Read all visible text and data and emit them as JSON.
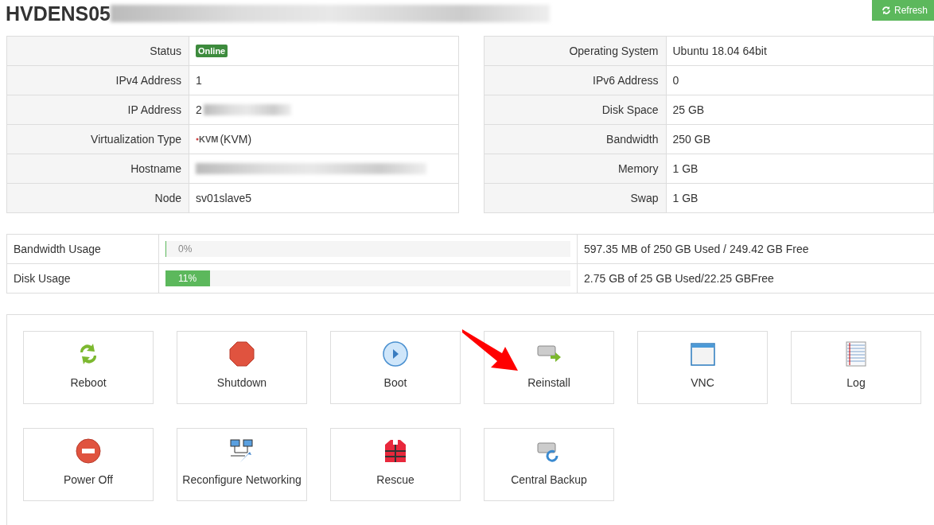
{
  "title": "HVDENS05",
  "refresh_button": {
    "label": "Refresh"
  },
  "info_left": [
    {
      "label": "Status",
      "kind": "badge",
      "value": "Online"
    },
    {
      "label": "IPv4 Address",
      "kind": "text",
      "value": "1"
    },
    {
      "label": "IP Address",
      "kind": "redacted",
      "value": "2"
    },
    {
      "label": "Virtualization Type",
      "kind": "logo",
      "logo": "KVM",
      "value": "(KVM)"
    },
    {
      "label": "Hostname",
      "kind": "redacted"
    },
    {
      "label": "Node",
      "kind": "text",
      "value": "sv01slave5"
    }
  ],
  "info_right": [
    {
      "label": "Operating System",
      "kind": "text",
      "value": "Ubuntu 18.04 64bit"
    },
    {
      "label": "IPv6 Address",
      "kind": "text",
      "value": "0"
    },
    {
      "label": "Disk Space",
      "kind": "text",
      "value": "25 GB"
    },
    {
      "label": "Bandwidth",
      "kind": "text",
      "value": "250 GB"
    },
    {
      "label": "Memory",
      "kind": "text",
      "value": "1 GB"
    },
    {
      "label": "Swap",
      "kind": "text",
      "value": "1 GB"
    }
  ],
  "usage": [
    {
      "label": "Bandwidth Usage",
      "level": 0,
      "percent": "0%",
      "summary": "597.35 MB of 250 GB Used / 249.42 GB Free"
    },
    {
      "label": "Disk Usage",
      "level": 0.11,
      "percent": "11%",
      "summary": "2.75 GB of 25 GB Used/22.25 GBFree"
    }
  ],
  "actions": [
    {
      "label": "Reboot"
    },
    {
      "label": "Shutdown"
    },
    {
      "label": "Boot"
    },
    {
      "label": "Reinstall",
      "pointed": true
    },
    {
      "label": "VNC"
    },
    {
      "label": "Log"
    },
    {
      "label": "Power Off"
    },
    {
      "label": "Reconfigure Networking"
    },
    {
      "label": "Rescue"
    },
    {
      "label": "Central Backup"
    }
  ]
}
